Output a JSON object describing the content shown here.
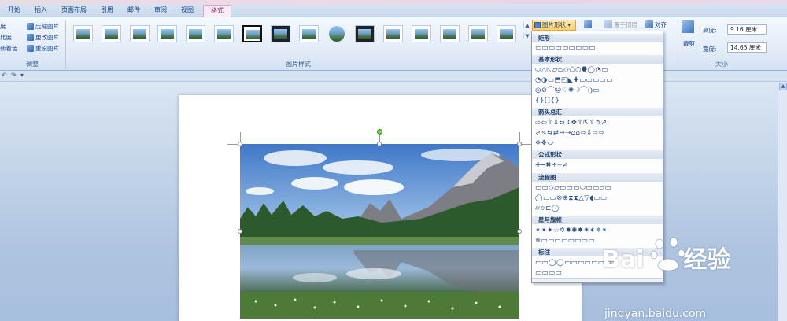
{
  "tabs": [
    {
      "label": "开始",
      "active": false
    },
    {
      "label": "插入",
      "active": false
    },
    {
      "label": "页面布局",
      "active": false
    },
    {
      "label": "引用",
      "active": false
    },
    {
      "label": "邮件",
      "active": false
    },
    {
      "label": "审阅",
      "active": false
    },
    {
      "label": "视图",
      "active": false
    },
    {
      "label": "格式",
      "active": true
    }
  ],
  "adjust": {
    "items": [
      "度",
      "比度",
      "新着色",
      "压缩图片",
      "更改图片",
      "重设图片"
    ],
    "label": "调整"
  },
  "styles": {
    "label": "图片样式",
    "more_up": "▲",
    "more_down": "▼"
  },
  "arrange": {
    "shapes_button": "图片形状",
    "bring_front": "置于顶层",
    "align": "对齐"
  },
  "size": {
    "crop": "裁剪",
    "height_label": "高度:",
    "height_value": "9.16 厘米",
    "width_label": "宽度:",
    "width_value": "14.65 厘米",
    "label": "大小"
  },
  "qat": {
    "undo": "↶",
    "redo": "↷"
  },
  "shapes_panel": {
    "sections": [
      {
        "title": "矩形",
        "rows": [
          "▭▭▭▭▭▭▭▭▭"
        ]
      },
      {
        "title": "基本形状",
        "rows": [
          "⬭△◺▱⏢◇⬠⬡⯃◯◔▭",
          "◔◑▭⬒◰◣✚▭▭▭▭▭",
          "◎⊘⌒☺♡✺☽⌒⦅⦆▭",
          "{}[]{}"
        ]
      },
      {
        "title": "箭头总汇",
        "rows": [
          "⇨⇦⇧⇩⇔⇕✥⇧⇱⇧↰⇗",
          "⇗⇖⇆⇄⇝⇢⌂⌂⇨⇩⇨⇨",
          "✥✥⤻"
        ]
      },
      {
        "title": "公式形状",
        "rows": [
          "✚━✖÷═≠"
        ]
      },
      {
        "title": "流程图",
        "rows": [
          "▭▭◇▱▭▭▭⬭▭▭▱▭",
          "◯▭▭⊗⊕⧗⧗△▽◖▭▭",
          "⌭⌭⊏◯"
        ]
      },
      {
        "title": "星与旗帜",
        "rows": [
          "✴✴✦☆✡✹✺✸✷✶✵✴",
          "✵▭▭▭▭▭▭▭▭"
        ]
      },
      {
        "title": "标注",
        "rows": [
          "▭▭◯◯▭▭▭▭▭▭▭▭",
          "▭▭▭▭"
        ]
      }
    ]
  },
  "watermark": {
    "logo_text": "Bai",
    "logo_text2": "经验",
    "url": "jingyan.baidu.com"
  }
}
